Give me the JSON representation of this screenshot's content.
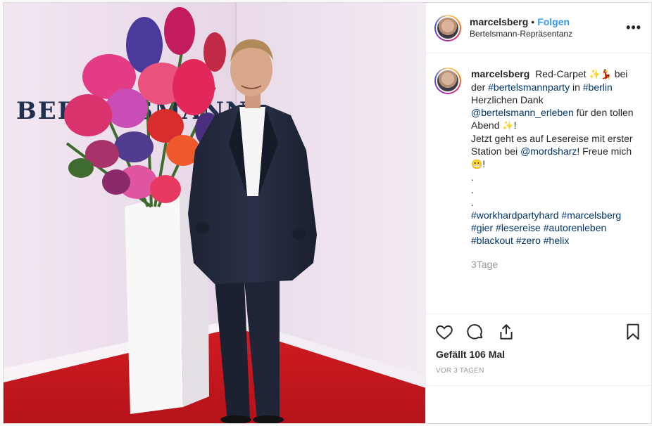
{
  "post": {
    "photo": {
      "wall_text": "BERTELSMANN"
    },
    "header": {
      "username": "marcelsberg",
      "separator": "•",
      "follow_label": "Folgen",
      "location": "Bertelsmann-Repräsentanz",
      "more_icon": "more-horizontal-icon"
    },
    "caption": {
      "username": "marcelsberg",
      "text_1": "Red-Carpet",
      "emoji_1": "✨",
      "emoji_2": "💃",
      "text_2": "bei der",
      "tag_1": "#bertelsmannparty",
      "text_3": "in",
      "tag_2": "#berlin",
      "line_2": "Herzlichen Dank",
      "mention_1": "@bertelsmann_erleben",
      "text_4": "für den tollen Abend",
      "emoji_3": "✨",
      "text_5": "!",
      "line_3": "Jetzt geht es auf Lesereise mit erster Station bei",
      "mention_2": "@mordsharz",
      "text_6": "! Freue mich",
      "emoji_4": "😬",
      "text_7": "!",
      "dots": [
        ".",
        ".",
        "."
      ],
      "hashtags_1": "#workhardpartyhard",
      "hashtags_2": "#marcelsberg",
      "hashtags_3": "#gier",
      "hashtags_4": "#lesereise",
      "hashtags_5": "#autorenleben",
      "hashtags_6": "#blackout",
      "hashtags_7": "#zero",
      "hashtags_8": "#helix",
      "age": "3Tage"
    },
    "actions": {
      "like_icon": "heart-icon",
      "comment_icon": "comment-icon",
      "share_icon": "share-icon",
      "save_icon": "bookmark-icon"
    },
    "likes": "Gefällt 106 Mal",
    "date": "VOR 3 TAGEN"
  },
  "colors": {
    "link": "#003569",
    "follow": "#3897f0",
    "muted": "#999999",
    "carpet": "#c8151b"
  }
}
